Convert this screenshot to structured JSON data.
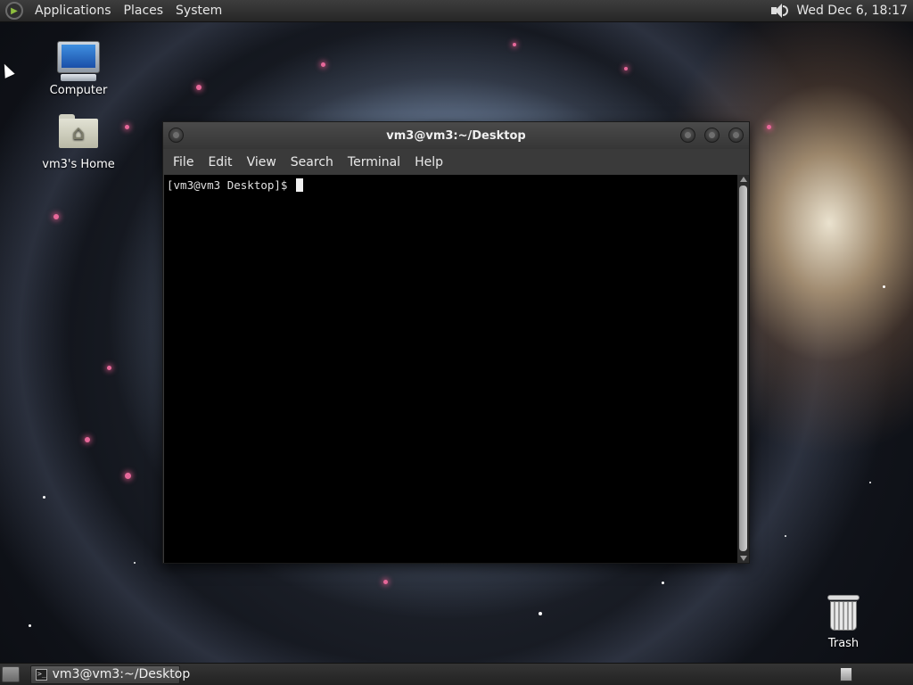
{
  "top_panel": {
    "menus": [
      "Applications",
      "Places",
      "System"
    ],
    "volume_icon": "speaker-icon",
    "clock": "Wed Dec  6, 18:17"
  },
  "desktop_icons": {
    "computer": "Computer",
    "home": "vm3's Home",
    "trash": "Trash"
  },
  "terminal_window": {
    "title": "vm3@vm3:~/Desktop",
    "menus": [
      "File",
      "Edit",
      "View",
      "Search",
      "Terminal",
      "Help"
    ],
    "prompt": "[vm3@vm3 Desktop]$ "
  },
  "bottom_panel": {
    "task_label": "vm3@vm3:~/Desktop"
  }
}
